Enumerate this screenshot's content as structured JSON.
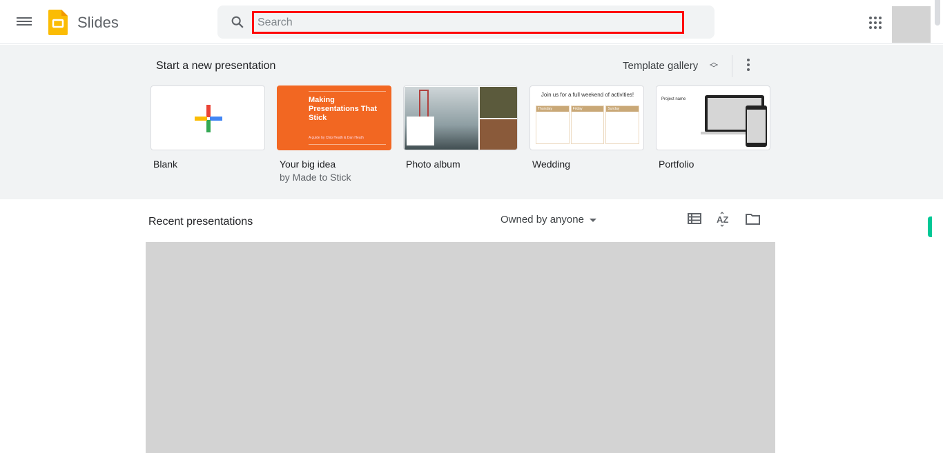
{
  "header": {
    "app_title": "Slides",
    "search_placeholder": "Search",
    "search_value": ""
  },
  "new_section": {
    "title": "Start a new presentation",
    "template_gallery_label": "Template gallery",
    "templates": [
      {
        "name": "Blank",
        "subtitle": ""
      },
      {
        "name": "Your big idea",
        "subtitle": "by Made to Stick",
        "thumb_title": "Making Presentations That Stick",
        "thumb_sub": "A guide by Chip Heath & Dan Heath"
      },
      {
        "name": "Photo album",
        "subtitle": ""
      },
      {
        "name": "Wedding",
        "subtitle": "",
        "thumb_title": "Join us for a full weekend of activities!",
        "thumb_days": [
          "Thursday",
          "Friday",
          "Sunday"
        ]
      },
      {
        "name": "Portfolio",
        "subtitle": "",
        "thumb_title": "Project name"
      }
    ]
  },
  "recent": {
    "title": "Recent presentations",
    "owner_filter": "Owned by anyone"
  },
  "colors": {
    "accent_orange": "#f26722",
    "logo_yellow": "#fbbc04",
    "search_highlight": "#ff0000",
    "green_tab": "#00c896"
  }
}
